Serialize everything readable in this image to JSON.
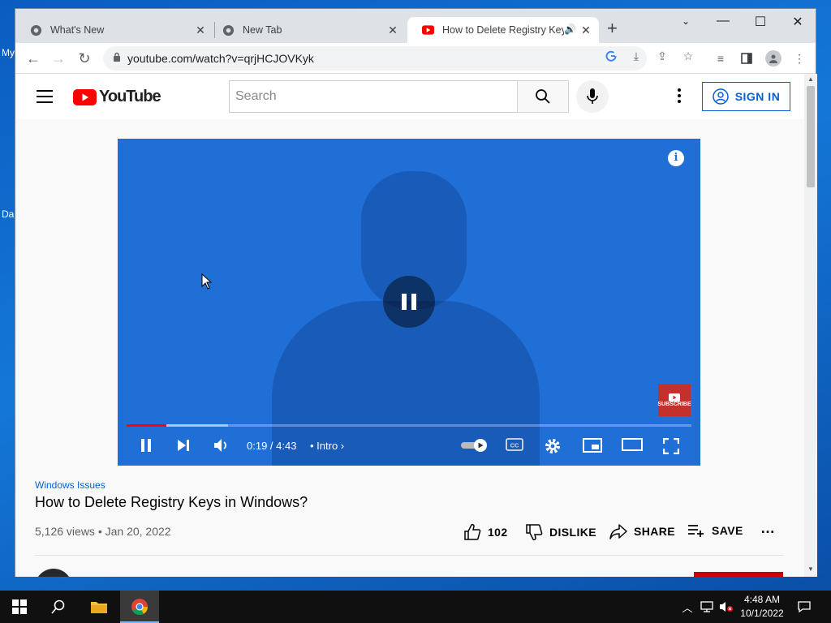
{
  "desktop": {
    "label_top": "My",
    "label_bottom": "Da"
  },
  "browser": {
    "tabs": [
      {
        "title": "What's New"
      },
      {
        "title": "New Tab"
      },
      {
        "title": "How to Delete Registry Keys"
      }
    ],
    "url": "youtube.com/watch?v=qrjHCJOVKyk"
  },
  "youtube": {
    "logo_text": "YouTube",
    "search_placeholder": "Search",
    "sign_in_label": "SIGN IN"
  },
  "player": {
    "current_time": "0:19 / 4:43",
    "chapter": "• Intro",
    "progress_played_fraction": 0.07,
    "progress_loaded_fraction": 0.18,
    "subscribe_badge": "SUBSCRIBE"
  },
  "video": {
    "channel_tag": "Windows Issues",
    "title": "How to Delete Registry Keys in Windows?",
    "views_date": "5,126 views • Jan 20, 2022",
    "like_count": "102",
    "dislike_label": "DISLIKE",
    "share_label": "SHARE",
    "save_label": "SAVE"
  },
  "taskbar": {
    "time": "4:48 AM",
    "date": "10/1/2022"
  },
  "colors": {
    "youtube_red": "#ff0000",
    "link_blue": "#065fd4",
    "player_overlay": "#1f6fd6"
  }
}
